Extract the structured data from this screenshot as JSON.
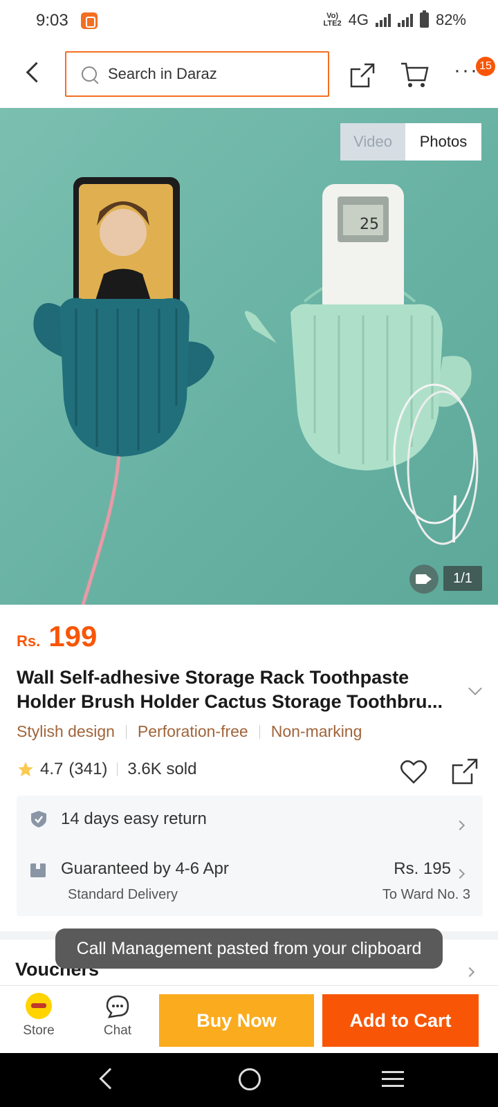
{
  "status_bar": {
    "time": "9:03",
    "network": "4G",
    "volte": "Vo) LTE2",
    "battery": "82%"
  },
  "header": {
    "search_placeholder": "Search in Daraz",
    "cart_badge": "15",
    "more": "···"
  },
  "gallery": {
    "tab_video": "Video",
    "tab_photos": "Photos",
    "counter": "1/1"
  },
  "product": {
    "currency": "Rs.",
    "price": "199",
    "title": "Wall Self-adhesive Storage Rack Toothpaste Holder Brush Holder Cactus Storage Toothbru...",
    "tags": [
      "Stylish design",
      "Perforation-free",
      "Non-marking"
    ],
    "rating": "4.7",
    "reviews": "(341)",
    "sold": "3.6K sold"
  },
  "service": {
    "return_text": "14 days easy return",
    "delivery_main": "Guaranteed by 4-6 Apr",
    "delivery_sub": "Standard Delivery",
    "delivery_fee": "Rs. 195",
    "delivery_dest": "To Ward No. 3"
  },
  "vouchers": {
    "title": "Vouchers"
  },
  "toast": {
    "message": "Call Management pasted from your clipboard"
  },
  "bottom_bar": {
    "store": "Store",
    "chat": "Chat",
    "buy_now": "Buy Now",
    "add_to_cart": "Add to Cart"
  },
  "colors": {
    "brand_orange": "#f85606",
    "buy_now": "#fbab1e",
    "tag_text": "#a0643a",
    "image_bg": "#6db4a6"
  }
}
